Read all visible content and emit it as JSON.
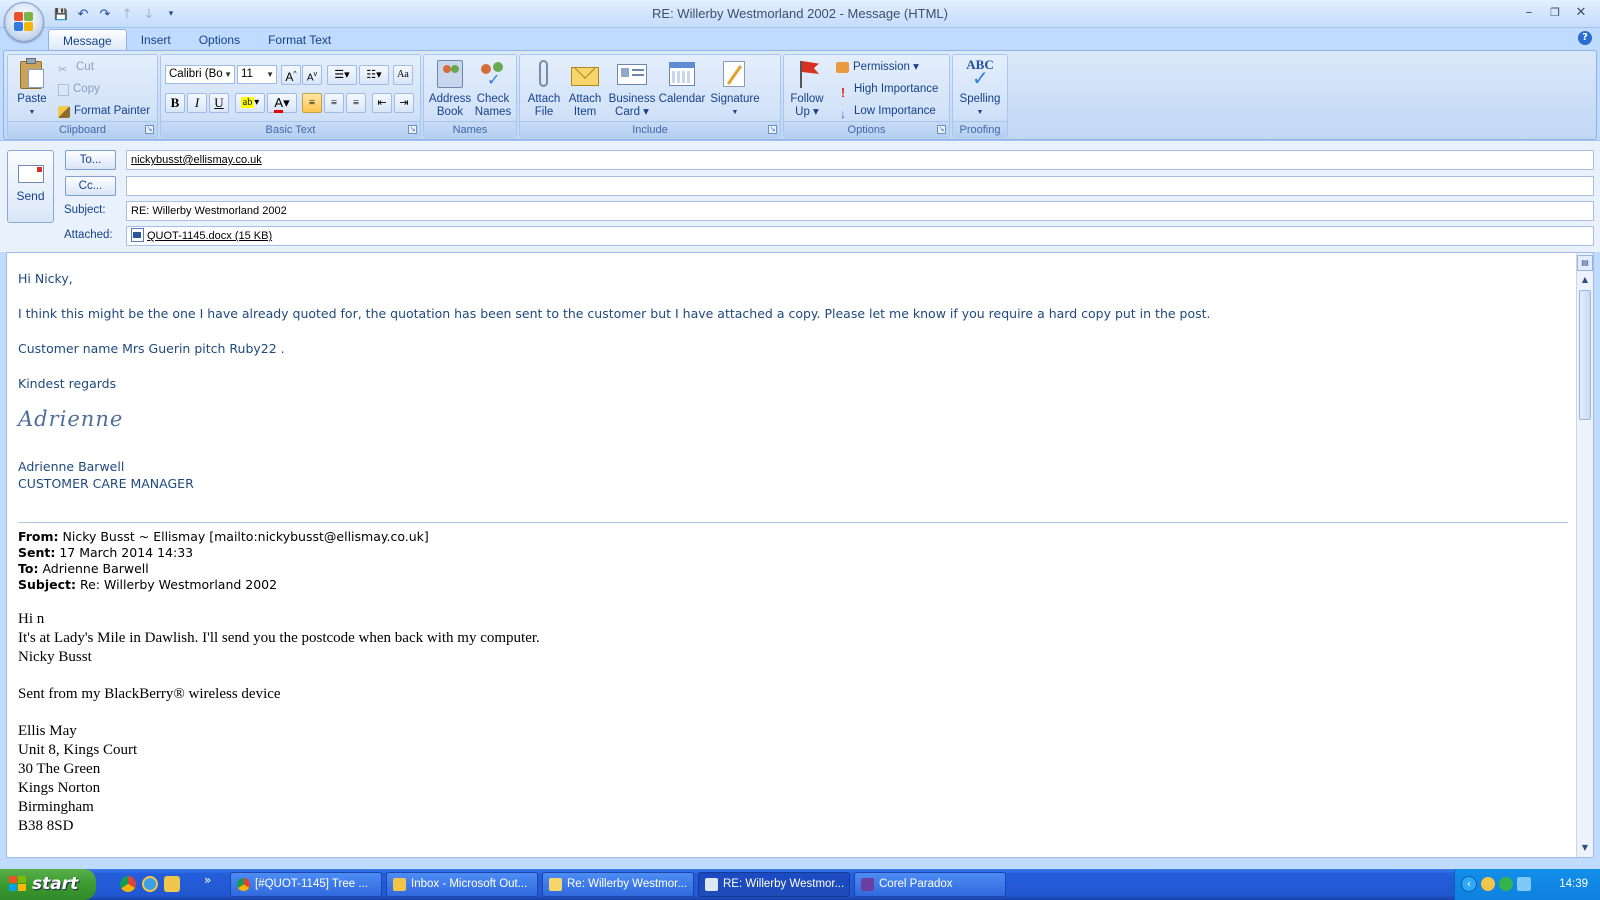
{
  "window": {
    "title": "RE: Willerby Westmorland 2002 - Message (HTML)",
    "minimize": "–",
    "maximize": "❐",
    "close": "✕"
  },
  "qat": {
    "save": "💾",
    "undo": "↶",
    "redo": "↷",
    "prev": "↑",
    "next": "↓",
    "customize": "▾"
  },
  "ribbon_tabs": [
    "Message",
    "Insert",
    "Options",
    "Format Text"
  ],
  "help": "?",
  "ribbon": {
    "clipboard": {
      "label": "Clipboard",
      "paste": "Paste",
      "cut": "Cut",
      "copy": "Copy",
      "format_painter": "Format Painter"
    },
    "basic_text": {
      "label": "Basic Text",
      "font": "Calibri (Bo",
      "size": "11",
      "bold": "B",
      "italic": "I",
      "underline": "U",
      "font_color_glyph": "A"
    },
    "names": {
      "label": "Names",
      "address_book": [
        "Address",
        "Book"
      ],
      "check_names": [
        "Check",
        "Names"
      ]
    },
    "include": {
      "label": "Include",
      "attach_file": [
        "Attach",
        "File"
      ],
      "attach_item": [
        "Attach",
        "Item"
      ],
      "business_card": [
        "Business",
        "Card ▾"
      ],
      "calendar": "Calendar",
      "signature": "Signature"
    },
    "options": {
      "label": "Options",
      "follow_up": [
        "Follow",
        "Up ▾"
      ],
      "permission": "Permission ▾",
      "high": "High Importance",
      "low": "Low Importance"
    },
    "proofing": {
      "label": "Proofing",
      "spelling": "Spelling",
      "abc": "ABC"
    }
  },
  "header": {
    "send": "Send",
    "to_button": "To...",
    "cc_button": "Cc...",
    "to_value": "nickybusst@ellismay.co.uk",
    "cc_value": "",
    "subject_label": "Subject:",
    "subject_value": "RE: Willerby Westmorland 2002",
    "attached_label": "Attached:",
    "attachment": "QUOT-1145.docx (15 KB)"
  },
  "body": {
    "greeting": "Hi Nicky,",
    "p1": "I think this might be the one I have already quoted for, the quotation has been sent to the customer but I have attached a copy.  Please let me know if you require a hard copy put in the post.",
    "p2": "Customer name Mrs Guerin pitch Ruby22 .",
    "closing": "Kindest regards",
    "signature_script": "Adrienne",
    "sender_name": "Adrienne Barwell",
    "sender_title": "CUSTOMER CARE MANAGER",
    "orig": {
      "from_label": "From:",
      "from": "Nicky Busst ~ Ellismay [mailto:nickybusst@ellismay.co.uk]",
      "sent_label": "Sent:",
      "sent": "17 March 2014 14:33",
      "to_label": "To:",
      "to": "Adrienne Barwell",
      "subject_label": "Subject:",
      "subject": "Re: Willerby Westmorland 2002"
    },
    "reply_lines": [
      "Hi n",
      "It's at Lady's Mile in Dawlish. I'll send you the postcode when back with my computer.",
      "Nicky Busst"
    ],
    "sent_from": "Sent from my BlackBerry® wireless device",
    "address": [
      "Ellis May",
      "Unit 8, Kings Court",
      "30 The Green",
      "Kings Norton",
      "Birmingham",
      "B38 8SD"
    ]
  },
  "taskbar": {
    "start": "start",
    "overflow": "»",
    "tasks": [
      "[#QUOT-1145] Tree ...",
      "Inbox - Microsoft Out...",
      "Re: Willerby Westmor...",
      "RE: Willerby Westmor...",
      "Corel Paradox"
    ],
    "tray_arrow": "‹",
    "clock": "14:39"
  }
}
